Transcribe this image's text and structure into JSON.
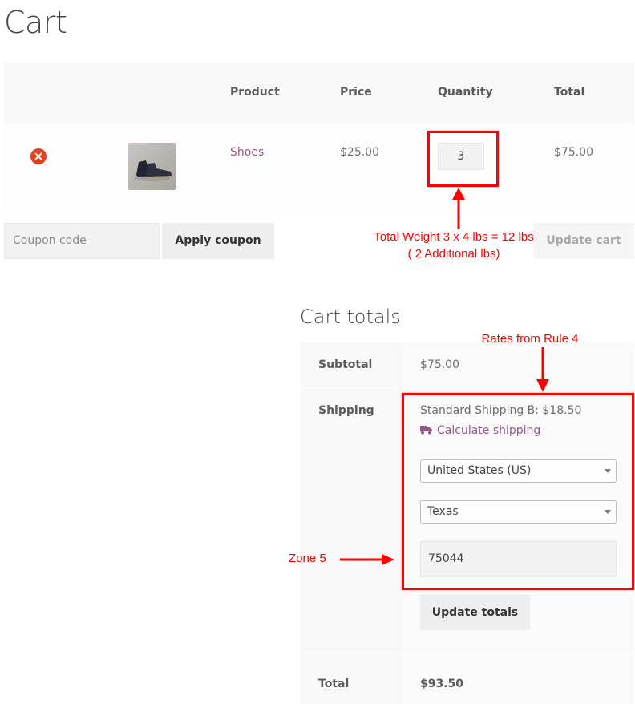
{
  "page": {
    "title": "Cart"
  },
  "cart_table": {
    "headers": {
      "product": "Product",
      "price": "Price",
      "quantity": "Quantity",
      "total": "Total"
    },
    "rows": [
      {
        "remove_icon": "remove-icon",
        "thumbnail": "shoes-thumbnail",
        "product": "Shoes",
        "price": "$25.00",
        "quantity": "3",
        "total": "$75.00"
      }
    ]
  },
  "coupon": {
    "placeholder": "Coupon code",
    "apply_label": "Apply coupon"
  },
  "update_cart_label": "Update cart",
  "cart_totals": {
    "title": "Cart totals",
    "subtotal_label": "Subtotal",
    "subtotal_value": "$75.00",
    "shipping_label": "Shipping",
    "shipping_method": "Standard Shipping B: $18.50",
    "calculate_shipping": "Calculate shipping",
    "country": "United States (US)",
    "state": "Texas",
    "postcode": "75044",
    "update_totals_label": "Update totals",
    "total_label": "Total",
    "total_value": "$93.50"
  },
  "annotations": {
    "weight_line1": "Total Weight 3 x 4 lbs = 12 lbs",
    "weight_line2": "( 2 Additional lbs)",
    "rates": "Rates from Rule 4",
    "zone": "Zone 5",
    "color": "#ff0000"
  },
  "colors": {
    "link": "#96588a",
    "remove": "#e2401c",
    "heading": "#43454b"
  }
}
